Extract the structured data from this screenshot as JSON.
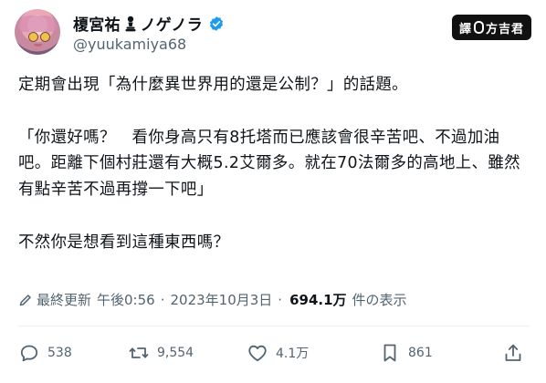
{
  "author": {
    "display_name_prefix": "榎宮祐",
    "display_name_suffix": "ノゲノラ",
    "handle": "@yuukamiya68",
    "verified": true
  },
  "badge": {
    "part1": "譯",
    "part2": "方吉君"
  },
  "tweet": {
    "text": "定期會出現「為什麼異世界用的還是公制？」的話題。\n\n「你還好嗎？　看你身高只有8托塔而已應該會很辛苦吧、不過加油吧。距離下個村莊還有大概5.2艾爾多。就在70法爾多的高地上、雖然有點辛苦不過再撐一下吧」\n\n不然你是想看到這種東西嗎？"
  },
  "meta": {
    "edited_label": "最終更新",
    "time": "午後0:56",
    "separator": "·",
    "date": "2023年10月3日",
    "views_count": "694.1万",
    "views_label": "件の表示"
  },
  "actions": {
    "reply_count": "538",
    "retweet_count": "9,554",
    "like_count": "4.1万",
    "bookmark_count": "861"
  },
  "colors": {
    "verified": "#1d9bf0",
    "muted": "#536471",
    "text": "#0f1419"
  }
}
